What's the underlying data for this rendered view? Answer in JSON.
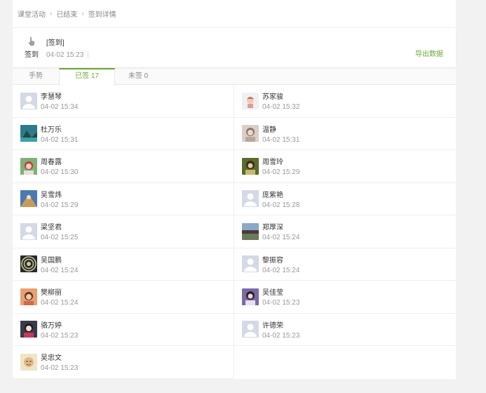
{
  "breadcrumb": [
    "课堂活动",
    "已结束",
    "签到详情"
  ],
  "header": {
    "type_label": "签到",
    "title": "[签到]",
    "time": "04-02 15:23",
    "export_label": "导出数据"
  },
  "tabs": [
    "手势",
    "已签 17",
    "未签 0"
  ],
  "students": [
    {
      "name": "李慧琴",
      "time": "04-02 15:34",
      "avatar": "placeholder-avatar"
    },
    {
      "name": "苏家骏",
      "time": "04-02 15:32",
      "avatar": "cartoon-avatar"
    },
    {
      "name": "杜万乐",
      "time": "04-02 15:31",
      "avatar": "landscape-avatar"
    },
    {
      "name": "温静",
      "time": "04-02 15:31",
      "avatar": "photo-avatar"
    },
    {
      "name": "周春露",
      "time": "04-02 15:30",
      "avatar": "photo-avatar"
    },
    {
      "name": "周雪玲",
      "time": "04-02 15:29",
      "avatar": "photo-avatar"
    },
    {
      "name": "吴雪炜",
      "time": "04-02 15:29",
      "avatar": "photo-avatar"
    },
    {
      "name": "庞紫艳",
      "time": "04-02 15:28",
      "avatar": "placeholder-avatar"
    },
    {
      "name": "梁坚君",
      "time": "04-02 15:25",
      "avatar": "placeholder-avatar"
    },
    {
      "name": "郑厚深",
      "time": "04-02 15:24",
      "avatar": "landscape-avatar"
    },
    {
      "name": "吴国鹏",
      "time": "04-02 15:24",
      "avatar": "pattern-avatar"
    },
    {
      "name": "黎振容",
      "time": "04-02 15:24",
      "avatar": "placeholder-avatar"
    },
    {
      "name": "樊柳丽",
      "time": "04-02 15:24",
      "avatar": "photo-avatar"
    },
    {
      "name": "吴佳莹",
      "time": "04-02 15:23",
      "avatar": "photo-avatar"
    },
    {
      "name": "骆万婷",
      "time": "04-02 15:23",
      "avatar": "photo-avatar"
    },
    {
      "name": "许德荣",
      "time": "04-02 15:23",
      "avatar": "placeholder-avatar"
    },
    {
      "name": "吴忠文",
      "time": "04-02 15:23",
      "avatar": "cartoon-avatar"
    }
  ],
  "colors": {
    "accent": "#6da836",
    "muted": "#999999",
    "placeholder_avatar": "#d4d9e6"
  }
}
